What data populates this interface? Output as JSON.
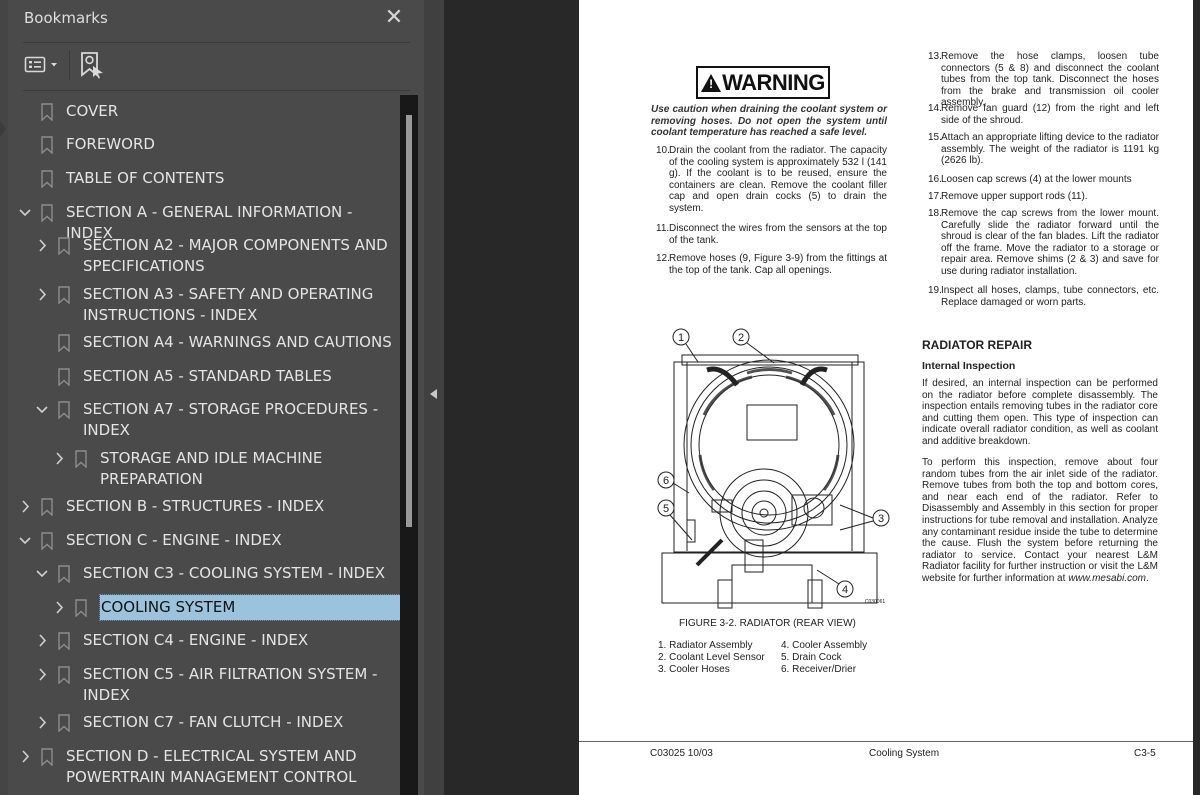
{
  "app": {
    "panel_title": "Bookmarks",
    "close_icon": "close-icon",
    "toolbar": {
      "options_icon": "list-options-icon",
      "dropdown_icon": "caret-down-icon",
      "find_bookmark_icon": "bookmark-search-icon"
    },
    "collapse_icon": "triangle-left-icon"
  },
  "bookmarks": [
    {
      "label": "COVER",
      "level": 0,
      "expander": "none"
    },
    {
      "label": "FOREWORD",
      "level": 0,
      "expander": "none"
    },
    {
      "label": "TABLE OF CONTENTS",
      "level": 0,
      "expander": "none"
    },
    {
      "label": "SECTION A - GENERAL INFORMATION - INDEX",
      "level": 0,
      "expander": "expanded"
    },
    {
      "label": "SECTION A2 - MAJOR COMPONENTS AND SPECIFICATIONS",
      "level": 1,
      "expander": "collapsed"
    },
    {
      "label": "SECTION A3 - SAFETY AND OPERATING INSTRUCTIONS - INDEX",
      "level": 1,
      "expander": "collapsed"
    },
    {
      "label": "SECTION A4 - WARNINGS AND CAUTIONS",
      "level": 1,
      "expander": "none"
    },
    {
      "label": "SECTION A5 - STANDARD TABLES",
      "level": 1,
      "expander": "none"
    },
    {
      "label": "SECTION A7 - STORAGE PROCEDURES - INDEX",
      "level": 1,
      "expander": "expanded"
    },
    {
      "label": "STORAGE AND IDLE MACHINE PREPARATION",
      "level": 2,
      "expander": "collapsed"
    },
    {
      "label": "SECTION B - STRUCTURES - INDEX",
      "level": 0,
      "expander": "collapsed"
    },
    {
      "label": "SECTION C - ENGINE - INDEX",
      "level": 0,
      "expander": "expanded"
    },
    {
      "label": "SECTION C3 - COOLING SYSTEM - INDEX",
      "level": 1,
      "expander": "expanded"
    },
    {
      "label": "COOLING SYSTEM",
      "level": 2,
      "expander": "collapsed",
      "selected": true
    },
    {
      "label": "SECTION C4 - ENGINE - INDEX",
      "level": 1,
      "expander": "collapsed"
    },
    {
      "label": "SECTION C5 - AIR FILTRATION SYSTEM - INDEX",
      "level": 1,
      "expander": "collapsed"
    },
    {
      "label": "SECTION C7 - FAN CLUTCH - INDEX",
      "level": 1,
      "expander": "collapsed"
    },
    {
      "label": "SECTION D - ELECTRICAL SYSTEM AND POWERTRAIN MANAGEMENT CONTROL",
      "level": 0,
      "expander": "collapsed"
    }
  ],
  "document": {
    "warning_label": "WARNING",
    "warning_text": "Use caution when draining the coolant system or removing hoses. Do not open the system until coolant temperature has reached a safe level.",
    "steps_left": [
      {
        "num": "10.",
        "text": "Drain the coolant from the radiator. The capacity of the cooling system is approximately 532 l (141 g). If the coolant is to be reused, ensure the containers are clean. Remove the coolant filler cap and open drain cocks (5) to drain the system."
      },
      {
        "num": "11.",
        "text": "Disconnect the wires from the sensors at the top of the tank."
      },
      {
        "num": "12.",
        "text": "Remove hoses (9, Figure 3-9) from the fittings at the top of the tank. Cap all openings."
      }
    ],
    "steps_right": [
      {
        "num": "13.",
        "text": "Remove the hose clamps, loosen tube connectors (5 & 8) and disconnect the coolant tubes from the top tank. Disconnect the hoses from the brake and transmission oil cooler assembly."
      },
      {
        "num": "14.",
        "text": "Remove fan guard (12) from the right and left side of the shroud."
      },
      {
        "num": "15.",
        "text": "Attach an appropriate lifting device to the radiator assembly. The weight of the radiator is 1191 kg (2626 lb)."
      },
      {
        "num": "16.",
        "text": "Loosen cap screws (4) at the lower mounts"
      },
      {
        "num": "17.",
        "text": "Remove upper support rods (11)."
      },
      {
        "num": "18.",
        "text": "Remove the cap screws from the lower mount. Carefully slide the radiator forward until the shroud is clear of the fan blades. Lift the radiator off the frame. Move the radiator to a storage or repair area. Remove shims (2 & 3) and save for use during radiator installation."
      },
      {
        "num": "19.",
        "text": "Inspect all hoses, clamps, tube connectors, etc. Replace damaged or worn parts."
      }
    ],
    "section_heading": "RADIATOR REPAIR",
    "subheading": "Internal Inspection",
    "para1": "If desired, an internal inspection can be performed on the radiator before complete disassembly. The inspection entails removing tubes in the radiator core and cutting them open. This type of inspection can indicate overall radiator condition, as well as coolant and additive breakdown.",
    "para2_pre": "To perform this inspection, remove about four random tubes from the air inlet side of the radiator. Remove tubes from both the top and bottom cores, and near each end of the radiator. Refer to Disassembly and Assembly in this section for proper instructions for tube removal and installation. Analyze any contaminant residue inside the tube to determine the cause. Flush the system before returning the radiator to service. Contact your nearest L&M Radiator facility for further instruction or visit the L&M website for further information at ",
    "para2_link": "www.mesabi.com",
    "para2_post": ".",
    "figure": {
      "callouts": [
        "1",
        "2",
        "3",
        "4",
        "5",
        "6"
      ],
      "code": "C030061",
      "caption": "FIGURE 3-2. RADIATOR (REAR VIEW)",
      "legend_left": [
        "1. Radiator Assembly",
        "2. Coolant Level Sensor",
        "3. Cooler Hoses"
      ],
      "legend_right": [
        "4. Cooler Assembly",
        "5. Drain Cock",
        "6. Receiver/Drier"
      ]
    },
    "footer": {
      "doc_code": "C03025  10/03",
      "title": "Cooling System",
      "page": "C3-5"
    }
  }
}
